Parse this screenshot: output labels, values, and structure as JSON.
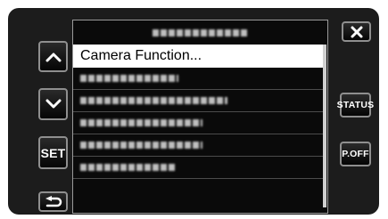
{
  "menu": {
    "header_blurred": true,
    "items": [
      {
        "label": "Camera Function...",
        "selected": true
      },
      {
        "label": "",
        "blurred": true
      },
      {
        "label": "",
        "blurred": true
      },
      {
        "label": "",
        "blurred": true
      },
      {
        "label": "",
        "blurred": true
      },
      {
        "label": "",
        "blurred": true
      },
      {
        "label": "",
        "blurred": true
      }
    ]
  },
  "left_buttons": {
    "up_icon": "chevron-up-icon",
    "down_icon": "chevron-down-icon",
    "set_label": "SET",
    "back_icon": "return-arrow-icon"
  },
  "right_buttons": {
    "close_icon": "close-icon",
    "status_label": "STATUS",
    "power_off_label": "P.OFF"
  },
  "colors": {
    "background": "#1c1c1c",
    "selected_row": "#ffffff",
    "button_border": "#8f8f8f"
  }
}
